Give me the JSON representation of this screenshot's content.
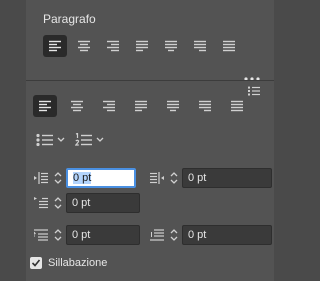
{
  "paragraph": {
    "title": "Paragrafo"
  },
  "alignment_icons": [
    "align-left-icon",
    "align-center-icon",
    "align-right-icon",
    "justify-left-icon",
    "justify-center-icon",
    "justify-right-icon",
    "justify-all-icon"
  ],
  "controls": {
    "left_indent_value": "0 pt",
    "right_indent_value": "0 pt",
    "first_line_indent_value": "0 pt",
    "space_before_value": "0 pt",
    "space_after_value": "0 pt"
  },
  "hyphenation": {
    "label": "Sillabazione",
    "checked": true
  },
  "colors": {
    "panel_bg": "#535353",
    "input_bg": "#3a3a3a",
    "focus_border": "#4a90e2",
    "selection_bg": "#b3d4fc"
  }
}
